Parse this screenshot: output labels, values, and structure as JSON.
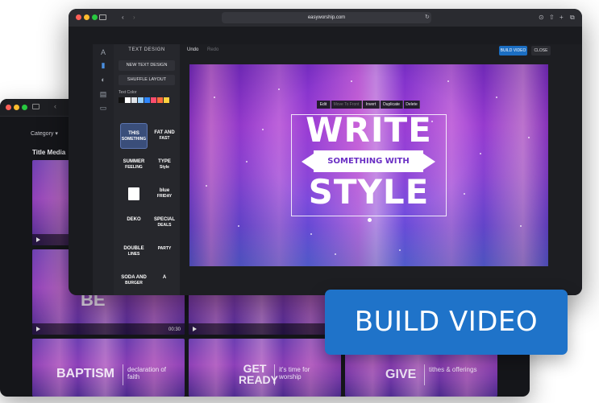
{
  "back_window": {
    "category_label": "Category ▾",
    "section_label": "Title Media",
    "thumbs": [
      {
        "big": "",
        "small": "",
        "duration": ""
      },
      {
        "big": "",
        "small": "",
        "duration": ""
      },
      {
        "big": "BE",
        "small": "",
        "duration": "00:30"
      },
      {
        "big": "BAPTISM",
        "small": "declaration of faith",
        "duration": ""
      },
      {
        "big": "GET READY",
        "small": "it's time for worship",
        "duration": ""
      },
      {
        "big": "GIVE",
        "small": "tithes & offerings",
        "duration": ""
      }
    ]
  },
  "browser": {
    "url": "easyworship.com"
  },
  "panel": {
    "title": "TEXT DESIGN",
    "new_design": "NEW TEXT DESIGN",
    "shuffle": "SHUFFLE LAYOUT",
    "text_color_label": "Text Color",
    "swatches": [
      "#111111",
      "#ffffff",
      "#dfe3e8",
      "#9ad1ff",
      "#2e86ff",
      "#ff4d6d",
      "#ff6b3d",
      "#ffd23f"
    ],
    "designs": [
      {
        "line1": "THIS",
        "line2": "SOMETHING"
      },
      {
        "line1": "FAT AND",
        "line2": "FAST"
      },
      {
        "line1": "SUMMER",
        "line2": "FEELING"
      },
      {
        "line1": "TYPE",
        "line2": "Style"
      },
      {
        "line1": "",
        "line2": ""
      },
      {
        "line1": "blue",
        "line2": "FRIDAY"
      },
      {
        "line1": "DEKO",
        "line2": ""
      },
      {
        "line1": "SPECIAL",
        "line2": "DEALS"
      },
      {
        "line1": "DOUBLE",
        "line2": "LINES"
      },
      {
        "line1": "",
        "line2": "PARTY"
      },
      {
        "line1": "SODA AND",
        "line2": "BURGER"
      },
      {
        "line1": "A",
        "line2": ""
      }
    ]
  },
  "editor": {
    "undo": "Undo",
    "redo": "Redo",
    "build_video": "BUILD VIDEO",
    "close": "CLOSE",
    "context_menu": [
      "Edit",
      "Move To Front",
      "Invert",
      "Duplicate",
      "Delete"
    ],
    "title_top": "WRITE",
    "title_ribbon": "SOMETHING WITH",
    "title_bottom": "STYLE"
  },
  "cta": {
    "label": "BUILD VIDEO",
    "color": "#1f73c9"
  }
}
